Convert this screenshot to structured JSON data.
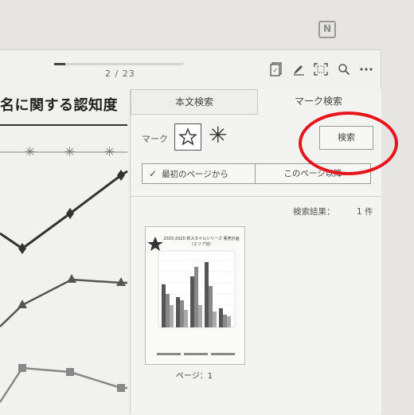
{
  "device": {
    "nfc_icon": "nfc-icon"
  },
  "viewer": {
    "page_indicator": "2 / 23",
    "page_progress": 0.087,
    "toolbar": [
      "annotate-list-icon",
      "pen-icon",
      "fit-page-icon",
      "search-icon",
      "more-icon"
    ],
    "document_title": "名に関する認知度"
  },
  "chart_data": {
    "type": "line",
    "title": "",
    "xlabel": "",
    "ylabel": "",
    "series": [
      {
        "values": [
          null,
          null,
          null,
          null
        ]
      },
      {
        "values": [
          null,
          null,
          null,
          null
        ]
      },
      {
        "values": [
          null,
          null,
          null,
          null
        ]
      },
      {
        "values": [
          null,
          null,
          null,
          null
        ]
      }
    ]
  },
  "search_panel": {
    "tab_text_search": "本文検索",
    "tab_mark_search": "マーク検索",
    "mark_label": "マーク",
    "search_button": "検索",
    "option_from_first": "最初のページから",
    "option_from_this": "このページ以降",
    "results_label": "検索結果：",
    "results_count": "1 件",
    "result_thumbnail_title": "2015-2020 新スタイルシリーズ 販売計画（エリア別）",
    "result_page": "ページ：1"
  },
  "annotation": {
    "highlight_color": "#e8141c"
  }
}
